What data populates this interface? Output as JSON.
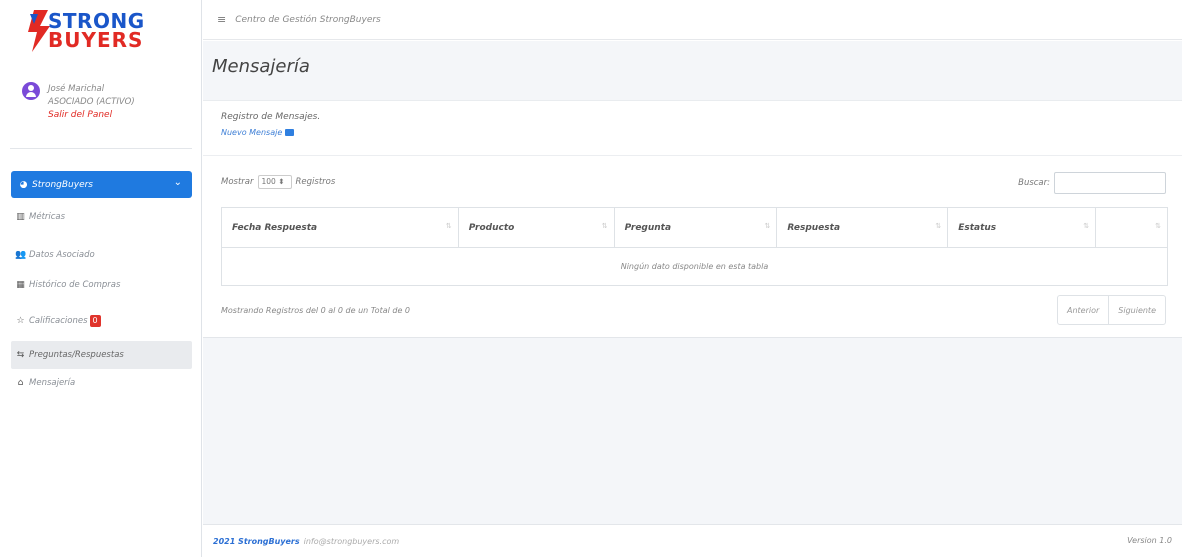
{
  "brand": {
    "line1": "STRONG",
    "line2": "BUYERS",
    "blue": "#1a56c9",
    "red": "#e12a24"
  },
  "user": {
    "name": "José Marichal",
    "role": "ASOCIADO (ACTIVO)",
    "logout": "Salir del Panel"
  },
  "sidebar": {
    "active": {
      "label": "StrongBuyers",
      "icon": "gauge-icon"
    },
    "items": [
      {
        "label": "Métricas",
        "icon": "bar-chart-icon"
      },
      {
        "label": "Datos Asociado",
        "icon": "users-icon"
      },
      {
        "label": "Histórico de Compras",
        "icon": "calendar-icon"
      },
      {
        "label": "Calificaciones",
        "icon": "star-icon",
        "badge": "0"
      },
      {
        "label": "Preguntas/Respuestas",
        "icon": "exchange-icon"
      },
      {
        "label": "Mensajería",
        "icon": "inbox-icon"
      }
    ]
  },
  "topbar": {
    "title": "Centro de Gestión StrongBuyers"
  },
  "page": {
    "title": "Mensajería"
  },
  "card": {
    "heading": "Registro de Mensajes.",
    "new_link": "Nuevo Mensaje"
  },
  "table": {
    "show_label": "Mostrar",
    "show_value": "100",
    "records_label": "Registros",
    "search_label": "Buscar:",
    "headers": [
      "Fecha Respuesta",
      "Producto",
      "Pregunta",
      "Respuesta",
      "Estatus",
      ""
    ],
    "empty": "Ningún dato disponible en esta tabla",
    "info": "Mostrando Registros del 0 al 0 de un Total de 0",
    "prev": "Anterior",
    "next": "Siguiente"
  },
  "footer": {
    "brand": "2021 StrongBuyers",
    "email": "info@strongbuyers.com",
    "version": "Version 1.0"
  }
}
